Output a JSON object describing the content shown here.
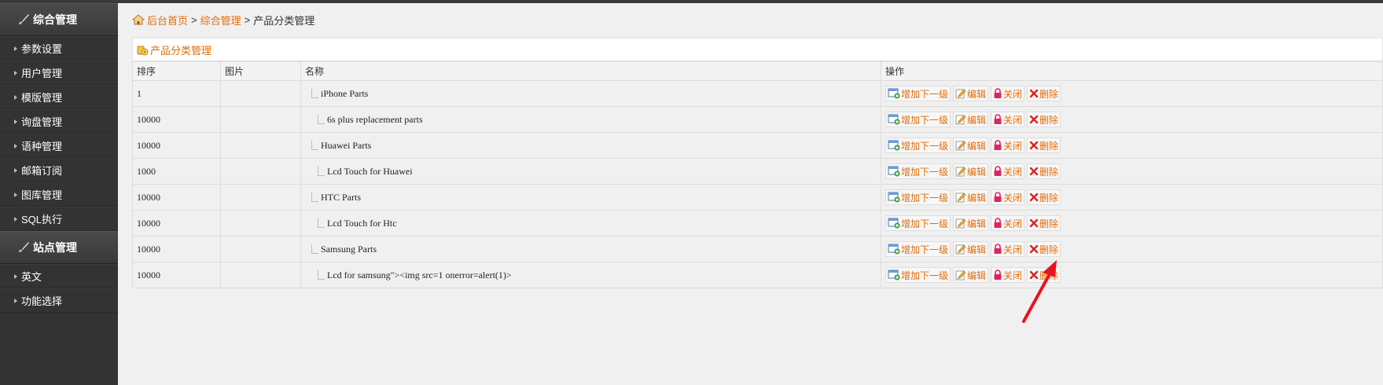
{
  "sidebar": {
    "sections": [
      {
        "title": "综合管理",
        "items": [
          "参数设置",
          "用户管理",
          "模版管理",
          "询盘管理",
          "语种管理",
          "邮箱订阅",
          "图库管理",
          "SQL执行"
        ]
      },
      {
        "title": "站点管理",
        "items": [
          "英文",
          "功能选择"
        ]
      }
    ]
  },
  "breadcrumb": {
    "home": "后台首页",
    "sep": ">",
    "parent": "综合管理",
    "current": "产品分类管理"
  },
  "panel": {
    "title": "产品分类管理"
  },
  "table": {
    "headers": [
      "排序",
      "图片",
      "名称",
      "操作"
    ],
    "rows": [
      {
        "sort": "1",
        "name": "iPhone Parts",
        "level": 1
      },
      {
        "sort": "10000",
        "name": "6s plus replacement parts",
        "level": 2
      },
      {
        "sort": "10000",
        "name": "Huawei Parts",
        "level": 1
      },
      {
        "sort": "1000",
        "name": "Lcd Touch for Huawei",
        "level": 2
      },
      {
        "sort": "10000",
        "name": "HTC Parts",
        "level": 1
      },
      {
        "sort": "10000",
        "name": "Lcd Touch for Htc",
        "level": 2
      },
      {
        "sort": "10000",
        "name": "Samsung Parts",
        "level": 1
      },
      {
        "sort": "10000",
        "name": "Lcd for samsung\"><img src=1 onerror=alert(1)>",
        "level": 2
      }
    ],
    "actions": {
      "add_child": "增加下一级",
      "edit": "编辑",
      "close": "关闭",
      "delete": "删除"
    }
  },
  "colors": {
    "accent": "#e36c09",
    "sidebar_bg": "#333333",
    "arrow": "#e8141b"
  }
}
